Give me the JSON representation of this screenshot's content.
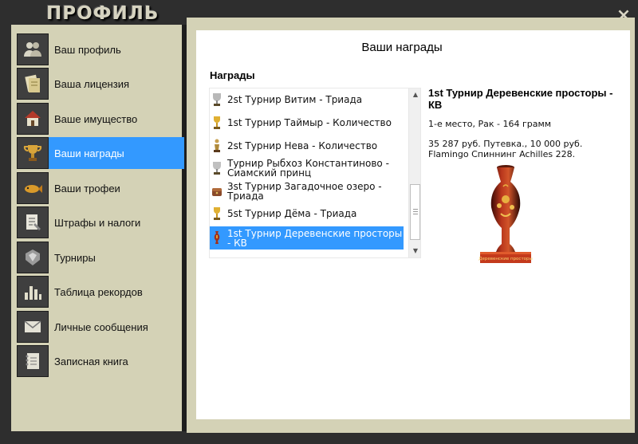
{
  "window": {
    "title": "ПРОФИЛЬ",
    "close_label": "×"
  },
  "sidebar": {
    "items": [
      {
        "label": "Ваш профиль",
        "icon": "users-icon",
        "active": false
      },
      {
        "label": "Ваша лицензия",
        "icon": "license-icon",
        "active": false
      },
      {
        "label": "Ваше имущество",
        "icon": "house-icon",
        "active": false
      },
      {
        "label": "Ваши награды",
        "icon": "trophy-icon",
        "active": true
      },
      {
        "label": "Ваши трофеи",
        "icon": "fish-icon",
        "active": false
      },
      {
        "label": "Штрафы и налоги",
        "icon": "document-icon",
        "active": false
      },
      {
        "label": "Турниры",
        "icon": "badge-icon",
        "active": false
      },
      {
        "label": "Таблица рекордов",
        "icon": "bar-chart-icon",
        "active": false
      },
      {
        "label": "Личные сообщения",
        "icon": "envelope-icon",
        "active": false
      },
      {
        "label": "Записная книга",
        "icon": "notebook-icon",
        "active": false
      }
    ]
  },
  "main": {
    "title": "Ваши награды",
    "section_heading": "Награды",
    "awards": [
      {
        "label": "2st Турнир Витим - Триада",
        "icon": "silver-cup-icon",
        "selected": false
      },
      {
        "label": "1st Турнир Таймыр - Количество",
        "icon": "gold-cup-icon",
        "selected": false
      },
      {
        "label": "2st Турнир Нева - Количество",
        "icon": "silver-statue-icon",
        "selected": false
      },
      {
        "label": "Турнир Рыбхоз Константиново - Сиамский принц",
        "icon": "silver-cup-icon",
        "selected": false
      },
      {
        "label": "3st Турнир Загадочное озеро - Триада",
        "icon": "bronze-chest-icon",
        "selected": false
      },
      {
        "label": "5st Турнир Дёма - Триада",
        "icon": "gold-cup-icon",
        "selected": false
      },
      {
        "label": "1st Турнир Деревенские просторы - КВ",
        "icon": "vase-icon",
        "selected": true
      }
    ],
    "detail": {
      "title": "1st Турнир Деревенские просторы - КВ",
      "place": "1-е место, Рак - 164 грамм",
      "prize": "35 287 руб. Путевка., 10 000 руб. Flamingo Спиннинг Achilles 228.",
      "image_caption": "Деревенские просторы"
    }
  },
  "colors": {
    "accent": "#3399ff",
    "frame": "#d4d2b6",
    "background": "#2e2e2e"
  }
}
